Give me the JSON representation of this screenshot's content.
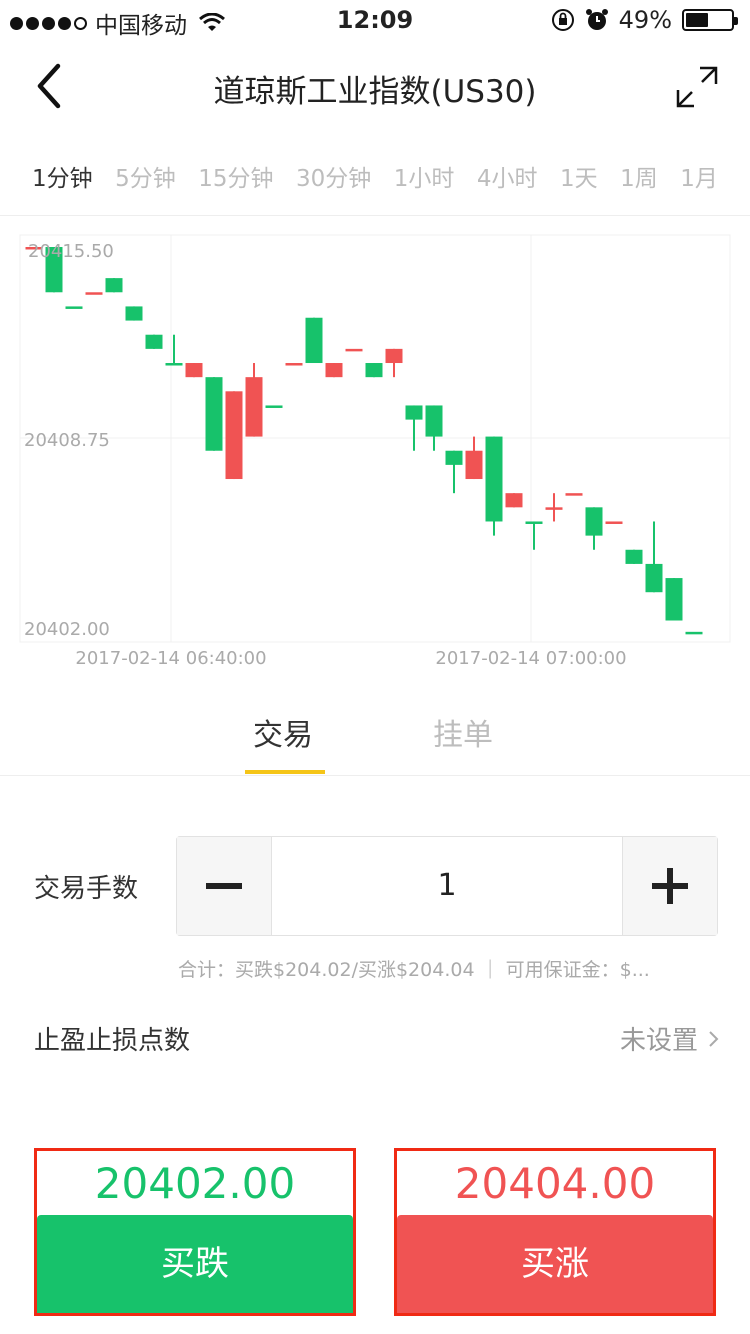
{
  "status_bar": {
    "carrier": "中国移动",
    "time": "12:09",
    "battery_percent": "49%",
    "battery_level": 0.49
  },
  "nav": {
    "title": "道琼斯工业指数(US30)",
    "back_icon": "chevron-left-icon",
    "expand_icon": "expand-icon"
  },
  "periods": [
    "1分钟",
    "5分钟",
    "15分钟",
    "30分钟",
    "1小时",
    "4小时",
    "1天",
    "1周",
    "1月"
  ],
  "active_period_index": 0,
  "chart_data": {
    "type": "candlestick",
    "y_ticks": [
      "20415.50",
      "20408.75",
      "20402.00"
    ],
    "x_ticks": [
      "2017-02-14 06:40:00",
      "2017-02-14 07:00:00"
    ],
    "ylim": [
      20402.0,
      20415.5
    ],
    "up_color": "#f05353",
    "down_color": "#17c26b",
    "candles": [
      {
        "o": 20415.5,
        "h": 20415.5,
        "l": 20415.5,
        "c": 20415.5,
        "up": true
      },
      {
        "o": 20415.5,
        "h": 20415.5,
        "l": 20413.9,
        "c": 20413.9,
        "up": false
      },
      {
        "o": 20413.4,
        "h": 20413.4,
        "l": 20413.4,
        "c": 20413.4,
        "up": false
      },
      {
        "o": 20413.9,
        "h": 20413.9,
        "l": 20413.9,
        "c": 20413.9,
        "up": true
      },
      {
        "o": 20414.4,
        "h": 20414.4,
        "l": 20413.9,
        "c": 20413.9,
        "up": false
      },
      {
        "o": 20413.4,
        "h": 20413.4,
        "l": 20412.9,
        "c": 20412.9,
        "up": false
      },
      {
        "o": 20412.4,
        "h": 20412.4,
        "l": 20411.9,
        "c": 20411.9,
        "up": false
      },
      {
        "o": 20411.4,
        "h": 20412.4,
        "l": 20411.4,
        "c": 20411.4,
        "up": false
      },
      {
        "o": 20410.9,
        "h": 20411.4,
        "l": 20410.9,
        "c": 20411.4,
        "up": true
      },
      {
        "o": 20410.9,
        "h": 20410.9,
        "l": 20408.3,
        "c": 20408.3,
        "up": false
      },
      {
        "o": 20407.3,
        "h": 20410.4,
        "l": 20407.3,
        "c": 20410.4,
        "up": true
      },
      {
        "o": 20408.8,
        "h": 20411.4,
        "l": 20408.8,
        "c": 20410.9,
        "up": true
      },
      {
        "o": 20409.9,
        "h": 20409.9,
        "l": 20409.9,
        "c": 20409.9,
        "up": false
      },
      {
        "o": 20411.4,
        "h": 20411.4,
        "l": 20411.4,
        "c": 20411.4,
        "up": true
      },
      {
        "o": 20413.0,
        "h": 20413.0,
        "l": 20411.4,
        "c": 20411.4,
        "up": false
      },
      {
        "o": 20410.9,
        "h": 20411.4,
        "l": 20410.9,
        "c": 20411.4,
        "up": true
      },
      {
        "o": 20411.9,
        "h": 20411.9,
        "l": 20411.9,
        "c": 20411.9,
        "up": true
      },
      {
        "o": 20411.4,
        "h": 20411.4,
        "l": 20410.9,
        "c": 20410.9,
        "up": false
      },
      {
        "o": 20411.4,
        "h": 20411.9,
        "l": 20410.9,
        "c": 20411.9,
        "up": true
      },
      {
        "o": 20409.9,
        "h": 20409.9,
        "l": 20408.3,
        "c": 20409.4,
        "up": false
      },
      {
        "o": 20409.9,
        "h": 20409.9,
        "l": 20408.3,
        "c": 20408.8,
        "up": false
      },
      {
        "o": 20408.3,
        "h": 20408.3,
        "l": 20406.8,
        "c": 20407.8,
        "up": false
      },
      {
        "o": 20407.3,
        "h": 20408.8,
        "l": 20407.3,
        "c": 20408.3,
        "up": true
      },
      {
        "o": 20408.8,
        "h": 20408.8,
        "l": 20405.3,
        "c": 20405.8,
        "up": false
      },
      {
        "o": 20406.3,
        "h": 20406.8,
        "l": 20406.3,
        "c": 20406.8,
        "up": true
      },
      {
        "o": 20405.8,
        "h": 20405.8,
        "l": 20404.8,
        "c": 20405.8,
        "up": false
      },
      {
        "o": 20406.3,
        "h": 20406.8,
        "l": 20405.8,
        "c": 20406.3,
        "up": true
      },
      {
        "o": 20406.8,
        "h": 20406.8,
        "l": 20406.8,
        "c": 20406.8,
        "up": true
      },
      {
        "o": 20406.3,
        "h": 20406.3,
        "l": 20404.8,
        "c": 20405.3,
        "up": false
      },
      {
        "o": 20405.8,
        "h": 20405.8,
        "l": 20405.8,
        "c": 20405.8,
        "up": true
      },
      {
        "o": 20404.8,
        "h": 20404.8,
        "l": 20404.3,
        "c": 20404.3,
        "up": false
      },
      {
        "o": 20404.3,
        "h": 20405.8,
        "l": 20403.3,
        "c": 20403.3,
        "up": false
      },
      {
        "o": 20403.8,
        "h": 20403.8,
        "l": 20402.3,
        "c": 20402.3,
        "up": false
      },
      {
        "o": 20401.9,
        "h": 20401.9,
        "l": 20401.9,
        "c": 20401.9,
        "up": false
      }
    ]
  },
  "trade_tabs": [
    "交易",
    "挂单"
  ],
  "lots": {
    "label": "交易手数",
    "value": "1",
    "minus_icon": "minus-icon",
    "plus_icon": "plus-icon"
  },
  "summary": "合计：买跌$204.02/买涨$204.04 ｜ 可用保证金：$...",
  "sltp": {
    "label": "止盈止损点数",
    "value": "未设置"
  },
  "sell": {
    "price": "20402.00",
    "label": "买跌"
  },
  "buy": {
    "price": "20404.00",
    "label": "买涨"
  }
}
